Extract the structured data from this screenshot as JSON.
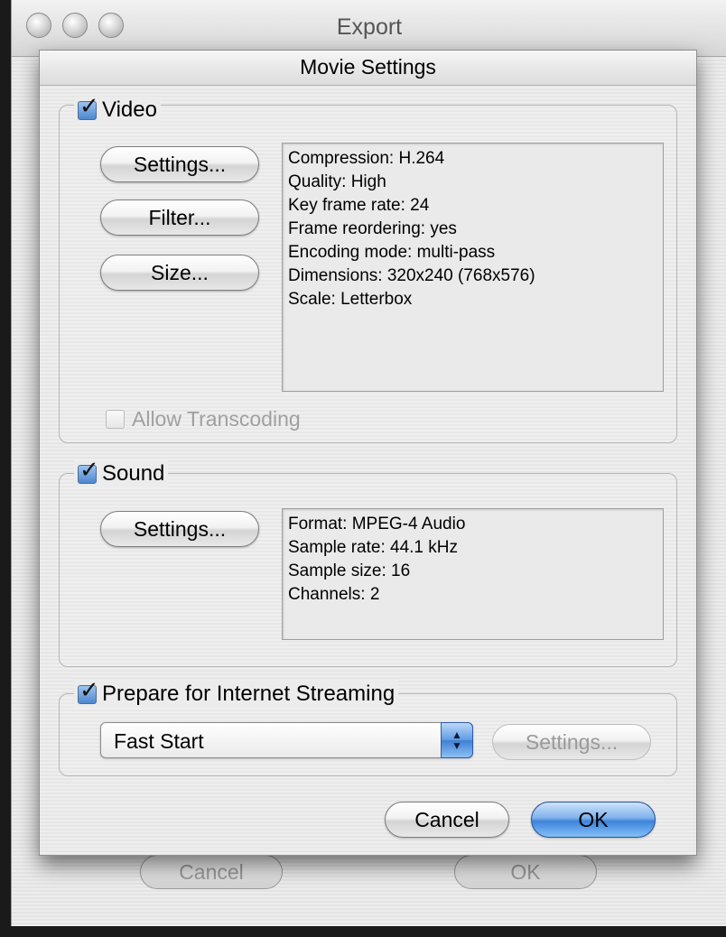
{
  "export_window": {
    "title": "Export",
    "cancel_label": "Cancel",
    "ok_label": "OK"
  },
  "sheet": {
    "title": "Movie Settings"
  },
  "video": {
    "label": "Video",
    "checked": true,
    "settings_label": "Settings...",
    "filter_label": "Filter...",
    "size_label": "Size...",
    "info": [
      "Compression: H.264",
      "Quality: High",
      "Key frame rate: 24",
      "Frame reordering: yes",
      "Encoding mode: multi-pass",
      "Dimensions: 320x240 (768x576)",
      "Scale: Letterbox"
    ],
    "allow_transcoding_label": "Allow Transcoding",
    "allow_transcoding_checked": false
  },
  "sound": {
    "label": "Sound",
    "checked": true,
    "settings_label": "Settings...",
    "info": [
      "Format: MPEG-4 Audio",
      "Sample rate: 44.1 kHz",
      "Sample size: 16",
      "Channels: 2"
    ]
  },
  "streaming": {
    "label": "Prepare for Internet Streaming",
    "checked": true,
    "selected": "Fast Start",
    "settings_label": "Settings..."
  },
  "footer": {
    "cancel_label": "Cancel",
    "ok_label": "OK"
  },
  "colors": {
    "accent": "#3d84db",
    "checkbox": "#4d86cf"
  },
  "icons": [
    "close-button-icon",
    "minimize-button-icon",
    "zoom-button-icon",
    "checkmark-icon",
    "popup-arrows-icon"
  ]
}
